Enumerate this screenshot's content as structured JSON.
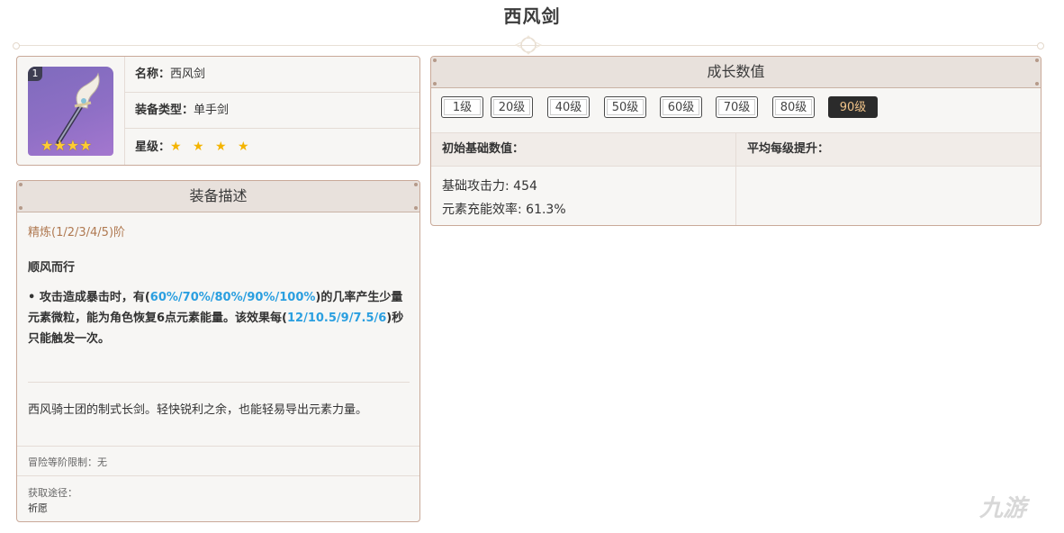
{
  "page": {
    "title": "西风剑"
  },
  "info": {
    "rank": "1",
    "stars_count": 4,
    "name_label": "名称：",
    "name_value": "西风剑",
    "type_label": "装备类型：",
    "type_value": "单手剑",
    "rarity_label": "星级：",
    "rarity_stars": "★ ★ ★ ★"
  },
  "description": {
    "header": "装备描述",
    "refinement": "精炼(1/2/3/4/5)阶",
    "skill_name": "顺风而行",
    "skill_text_1": "• 攻击造成暴击时，有(",
    "skill_hl_1": "60%/70%/80%/90%/100%",
    "skill_text_2": ")的几率产生少量元素微粒，能为角色恢复6点元素能量。该效果每(",
    "skill_hl_2": "12/10.5/9/7.5/6",
    "skill_text_3": ")秒只能触发一次。",
    "lore": "西风骑士团的制式长剑。轻快锐利之余，也能轻易导出元素力量。",
    "ascension_limit": "冒险等阶限制：无",
    "obtain_label": "获取途径：",
    "obtain_value": "祈愿"
  },
  "growth": {
    "header": "成长数值",
    "levels": [
      "1级",
      "20级",
      "40级",
      "50级",
      "60级",
      "70级",
      "80级",
      "90级"
    ],
    "active_level": "90级",
    "base_header": "初始基础数值：",
    "avg_header": "平均每级提升：",
    "stat_1": "基础攻击力: 454",
    "stat_2": "元素充能效率: 61.3%"
  },
  "watermark": "九游",
  "colors": {
    "accent_blue": "#2b9fe0",
    "refine_brown": "#b07a52",
    "star_gold": "#f4b400",
    "active_btn_bg": "#2b2b2b"
  }
}
